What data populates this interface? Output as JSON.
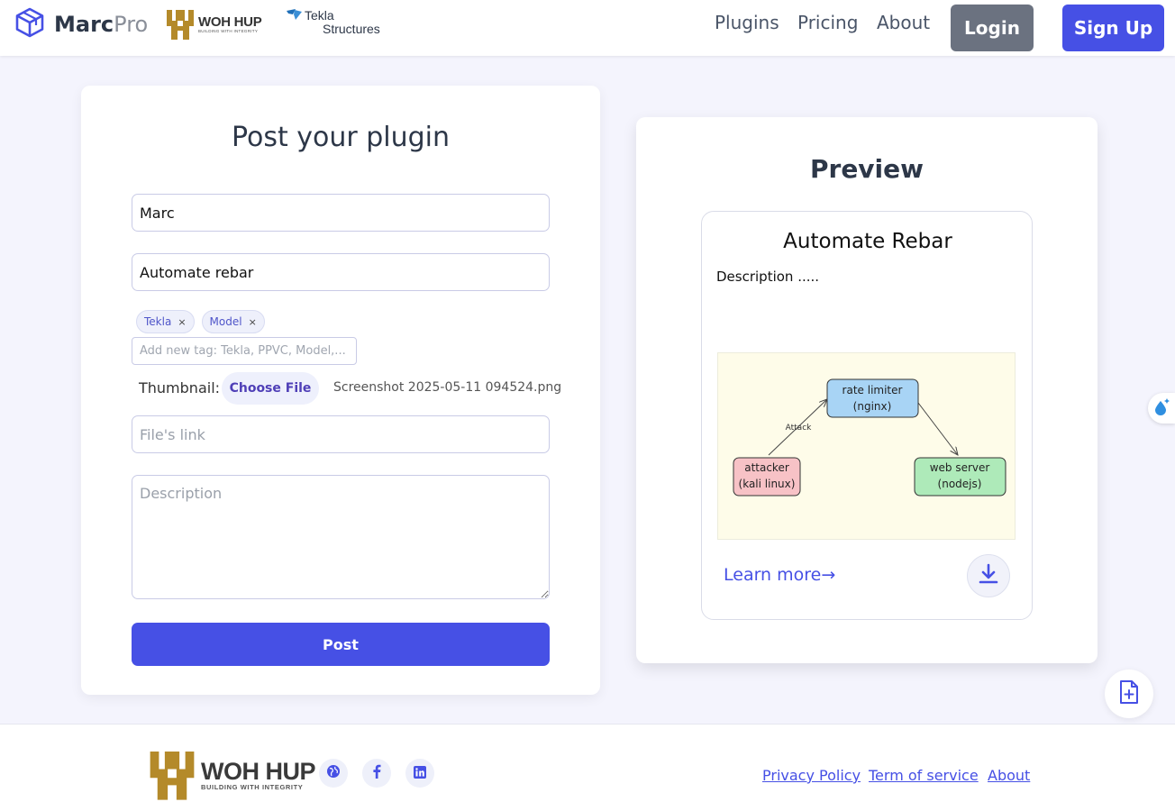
{
  "brand": {
    "name": "Marc",
    "suffix": "Pro"
  },
  "partners": {
    "wohhup_name": "WOH HUP",
    "wohhup_tagline": "BUILDING WITH INTEGRITY",
    "tekla_line1": "Tekla",
    "tekla_line2": "Structures"
  },
  "nav": {
    "links": [
      "Plugins",
      "Pricing",
      "About"
    ],
    "login": "Login",
    "signup": "Sign Up"
  },
  "form": {
    "title": "Post your plugin",
    "author_value": "Marc",
    "name_value": "Automate rebar",
    "tags": [
      "Tekla",
      "Model"
    ],
    "tag_remove_glyph": "×",
    "tag_placeholder": "Add new tag: Tekla, PPVC, Model,...",
    "thumbnail_label": "Thumbnail:",
    "choose_file": "Choose File",
    "file_name": "Screenshot 2025-05-11 094524.png",
    "link_placeholder": "File's link",
    "description_placeholder": "Description",
    "post_button": "Post"
  },
  "preview": {
    "title": "Preview",
    "plugin_title": "Automate Rebar",
    "description": "Description .....",
    "learn_more": "Learn more→",
    "diagram": {
      "rate_limiter": [
        "rate limiter",
        "(nginx)"
      ],
      "attacker": [
        "attacker",
        "(kali linux)"
      ],
      "web_server": [
        "web server",
        "(nodejs)"
      ],
      "edge_label": "Attack"
    }
  },
  "footer": {
    "wohhup_name": "WOH HUP",
    "wohhup_tagline": "BUILDING WITH INTEGRITY",
    "links": [
      "Privacy Policy",
      "Term of service",
      "About"
    ]
  },
  "icons": {
    "logo": "cube-icon",
    "social": [
      "globe-icon",
      "facebook-icon",
      "linkedin-icon"
    ],
    "download": "download-icon",
    "floating": [
      "droplet-icon",
      "file-plus-icon"
    ]
  },
  "colors": {
    "primary": "#4650e5",
    "login": "#6b7280",
    "background": "#f4f4fd",
    "wohhup_gold": "#b48a2a"
  }
}
